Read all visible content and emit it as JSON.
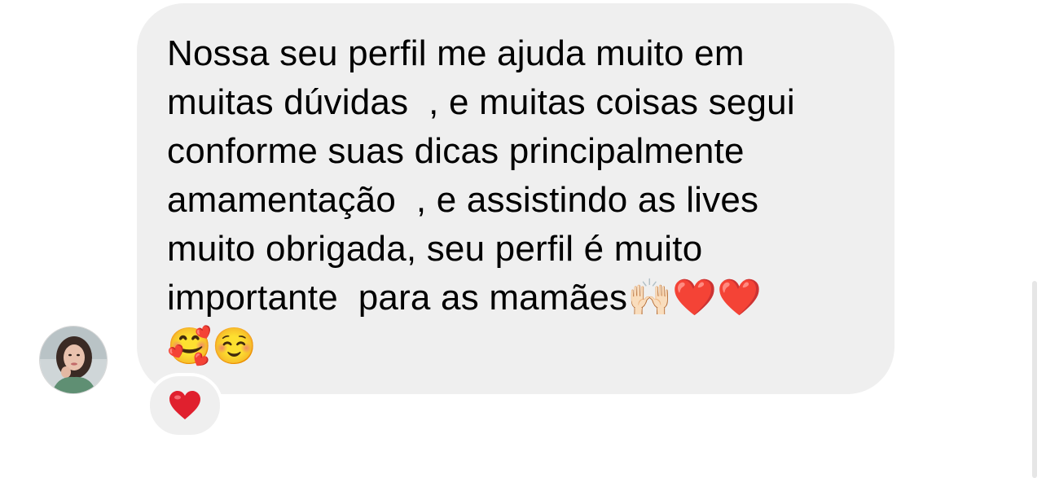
{
  "conversation": {
    "message": {
      "text": "Nossa seu perfil me ajuda muito em\nmuitas dúvidas  , e muitas coisas segui\nconforme suas dicas principalmente\namamentação  , e assistindo as lives\nmuito obrigada, seu perfil é muito\nimportante  para as mamães🙌🏻❤️❤️\n🥰☺️"
    },
    "reaction": {
      "icon": "red-heart-icon",
      "color": "#e0202e"
    },
    "sender": {
      "avatar_icon": "profile-photo"
    }
  },
  "colors": {
    "bubble": "#efefef",
    "background": "#ffffff",
    "text": "#000000"
  }
}
